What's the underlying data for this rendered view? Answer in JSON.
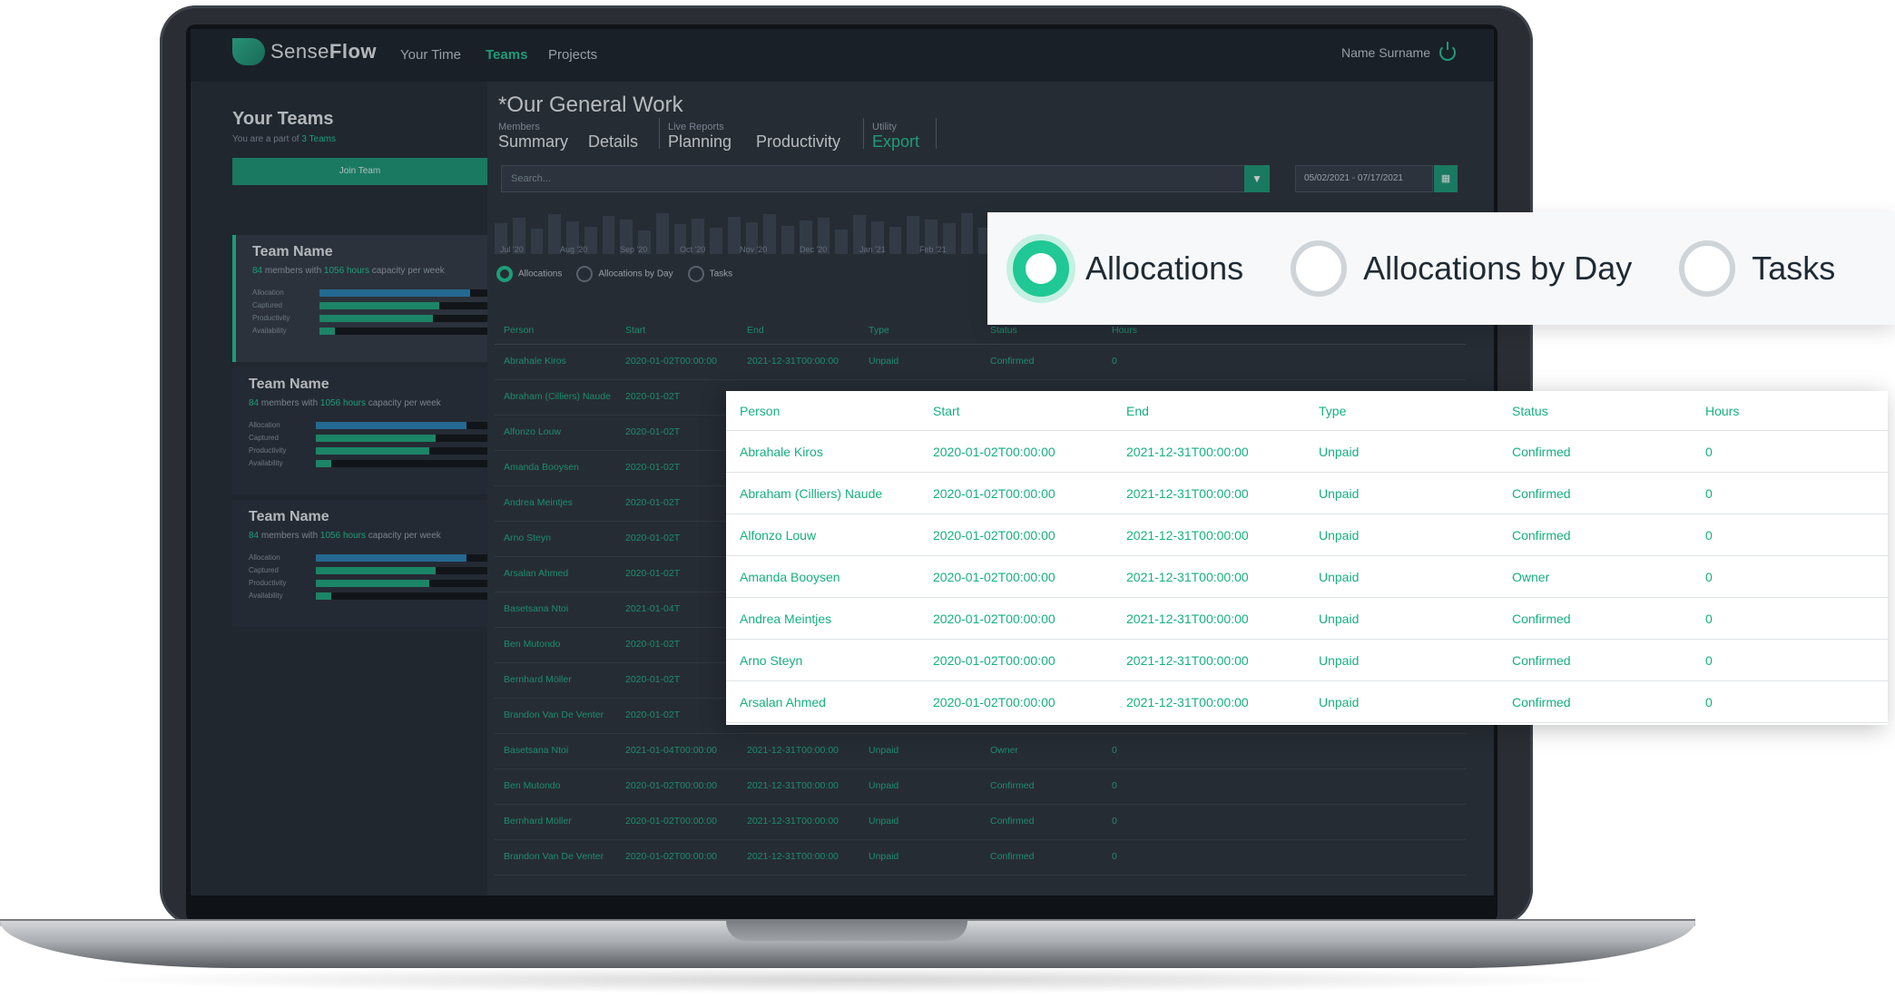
{
  "app": {
    "brand_light": "Sense",
    "brand_bold": "Flow",
    "nav": [
      "Your Time",
      "Teams",
      "Projects"
    ],
    "user": "Name Surname"
  },
  "sidebar": {
    "title": "Your Teams",
    "subtitle_prefix": "You are a part of ",
    "subtitle_link": "3 Teams",
    "join_label": "Join Team",
    "teams": [
      {
        "name": "Team Name",
        "members": "84",
        "mid": " members with ",
        "hours": "1056 hours",
        "tail": " capacity per week",
        "metrics": [
          {
            "label": "Allocation",
            "value": 0.88
          },
          {
            "label": "Captured",
            "value": 0.7
          },
          {
            "label": "Productivity",
            "value": 0.66
          },
          {
            "label": "Availability",
            "value": 0.09
          }
        ]
      },
      {
        "name": "Team Name",
        "members": "84",
        "mid": " members with ",
        "hours": "1056 hours",
        "tail": " capacity per week",
        "metrics": [
          {
            "label": "Allocation",
            "value": 0.88
          },
          {
            "label": "Captured",
            "value": 0.7
          },
          {
            "label": "Productivity",
            "value": 0.66
          },
          {
            "label": "Availability",
            "value": 0.09
          }
        ]
      },
      {
        "name": "Team Name",
        "members": "84",
        "mid": " members with ",
        "hours": "1056 hours",
        "tail": " capacity per week",
        "metrics": [
          {
            "label": "Allocation",
            "value": 0.88
          },
          {
            "label": "Captured",
            "value": 0.7
          },
          {
            "label": "Productivity",
            "value": 0.66
          },
          {
            "label": "Availability",
            "value": 0.09
          }
        ]
      }
    ]
  },
  "main": {
    "title": "*Our General Work",
    "groups": {
      "members": "Members",
      "live": "Live Reports",
      "utility": "Utility"
    },
    "tabs": {
      "summary": "Summary",
      "details": "Details",
      "planning": "Planning",
      "productivity": "Productivity",
      "export": "Export"
    },
    "search_placeholder": "Search...",
    "date_range": "05/02/2021 - 07/17/2021",
    "months": [
      "Jul '20",
      "Aug '20",
      "Sep '20",
      "Oct '20",
      "Nov '20",
      "Dec '20",
      "Jan '21",
      "Feb '21"
    ],
    "radios": [
      "Allocations",
      "Allocations by Day",
      "Tasks"
    ],
    "columns": [
      "Person",
      "Start",
      "End",
      "Type",
      "Status",
      "Hours"
    ],
    "rows": [
      [
        "Abrahale Kiros",
        "2020-01-02T00:00:00",
        "2021-12-31T00:00:00",
        "Unpaid",
        "Confirmed",
        "0"
      ],
      [
        "Abraham (Cilliers) Naude",
        "2020-01-02T",
        "",
        "",
        "",
        ""
      ],
      [
        "Alfonzo Louw",
        "2020-01-02T",
        "",
        "",
        "",
        ""
      ],
      [
        "Amanda Booysen",
        "2020-01-02T",
        "",
        "",
        "",
        ""
      ],
      [
        "Andrea Meintjes",
        "2020-01-02T",
        "",
        "",
        "",
        ""
      ],
      [
        "Arno Steyn",
        "2020-01-02T",
        "",
        "",
        "",
        ""
      ],
      [
        "Arsalan Ahmed",
        "2020-01-02T",
        "",
        "",
        "",
        ""
      ],
      [
        "Basetsana Ntoi",
        "2021-01-04T",
        "",
        "",
        "",
        ""
      ],
      [
        "Ben Mutondo",
        "2020-01-02T",
        "",
        "",
        "",
        ""
      ],
      [
        "Bernhard Möller",
        "2020-01-02T",
        "",
        "",
        "",
        ""
      ],
      [
        "Brandon Van De Venter",
        "2020-01-02T",
        "",
        "",
        "",
        ""
      ],
      [
        "Basetsana Ntoi",
        "2021-01-04T00:00:00",
        "2021-12-31T00:00:00",
        "Unpaid",
        "Owner",
        "0"
      ],
      [
        "Ben Mutondo",
        "2020-01-02T00:00:00",
        "2021-12-31T00:00:00",
        "Unpaid",
        "Confirmed",
        "0"
      ],
      [
        "Bernhard Möller",
        "2020-01-02T00:00:00",
        "2021-12-31T00:00:00",
        "Unpaid",
        "Confirmed",
        "0"
      ],
      [
        "Brandon Van De Venter",
        "2020-01-02T00:00:00",
        "2021-12-31T00:00:00",
        "Unpaid",
        "Confirmed",
        "0"
      ]
    ]
  },
  "zoom_radios": [
    "Allocations",
    "Allocations by Day",
    "Tasks"
  ],
  "zoom_table": {
    "columns": [
      "Person",
      "Start",
      "End",
      "Type",
      "Status",
      "Hours"
    ],
    "rows": [
      [
        "Abrahale Kiros",
        "2020-01-02T00:00:00",
        "2021-12-31T00:00:00",
        "Unpaid",
        "Confirmed",
        "0"
      ],
      [
        "Abraham (Cilliers) Naude",
        "2020-01-02T00:00:00",
        "2021-12-31T00:00:00",
        "Unpaid",
        "Confirmed",
        "0"
      ],
      [
        "Alfonzo Louw",
        "2020-01-02T00:00:00",
        "2021-12-31T00:00:00",
        "Unpaid",
        "Confirmed",
        "0"
      ],
      [
        "Amanda Booysen",
        "2020-01-02T00:00:00",
        "2021-12-31T00:00:00",
        "Unpaid",
        "Owner",
        "0"
      ],
      [
        "Andrea Meintjes",
        "2020-01-02T00:00:00",
        "2021-12-31T00:00:00",
        "Unpaid",
        "Confirmed",
        "0"
      ],
      [
        "Arno Steyn",
        "2020-01-02T00:00:00",
        "2021-12-31T00:00:00",
        "Unpaid",
        "Confirmed",
        "0"
      ],
      [
        "Arsalan Ahmed",
        "2020-01-02T00:00:00",
        "2021-12-31T00:00:00",
        "Unpaid",
        "Confirmed",
        "0"
      ]
    ]
  },
  "colors": {
    "accent": "#20c997",
    "bar_allocation": "#2a84b8",
    "bar_green": "#1fa981"
  }
}
